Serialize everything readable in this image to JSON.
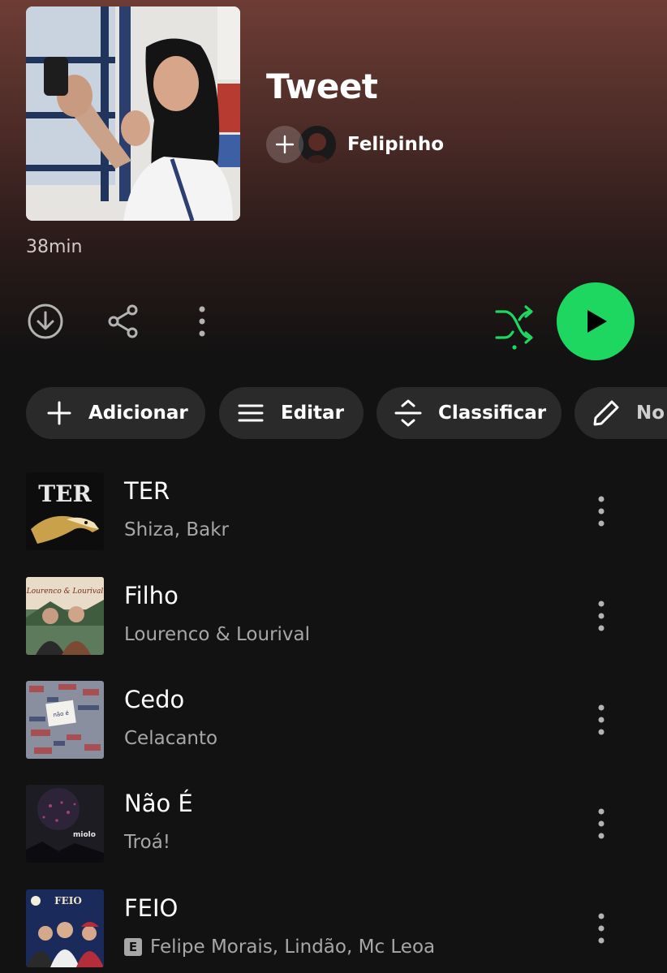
{
  "playlist": {
    "title": "Tweet",
    "owner": "Felipinho",
    "duration": "38min"
  },
  "icons": {
    "add_collaborator": "plus-icon",
    "download": "download-icon",
    "share": "share-icon",
    "more": "more-vertical-icon",
    "shuffle": "shuffle-icon",
    "play": "play-icon"
  },
  "colors": {
    "accent": "#1ed760",
    "header_gradient_top": "#6d3d35",
    "background": "#121212",
    "chip_bg": "#2a2a2a",
    "secondary_text": "#a7a7a7"
  },
  "chips": [
    {
      "label": "Adicionar",
      "icon": "plus-icon"
    },
    {
      "label": "Editar",
      "icon": "list-icon"
    },
    {
      "label": "Classificar",
      "icon": "sort-icon"
    },
    {
      "label": "No",
      "icon": "pencil-icon"
    }
  ],
  "tracks": [
    {
      "name": "TER",
      "artist": "Shiza, Bakr",
      "explicit": false
    },
    {
      "name": "Filho",
      "artist": "Lourenco & Lourival",
      "explicit": false
    },
    {
      "name": "Cedo",
      "artist": "Celacanto",
      "explicit": false
    },
    {
      "name": "Não É",
      "artist": "Troá!",
      "explicit": false
    },
    {
      "name": "FEIO",
      "artist": "Felipe Morais, Lindão, Mc Leoa",
      "explicit": true,
      "explicit_label": "E"
    }
  ],
  "album_art_text": {
    "ter": "TER",
    "filho": "Lourenco & Lourival",
    "cedo_note": "não é",
    "naoe": "miolo",
    "feio": "FEIO"
  }
}
